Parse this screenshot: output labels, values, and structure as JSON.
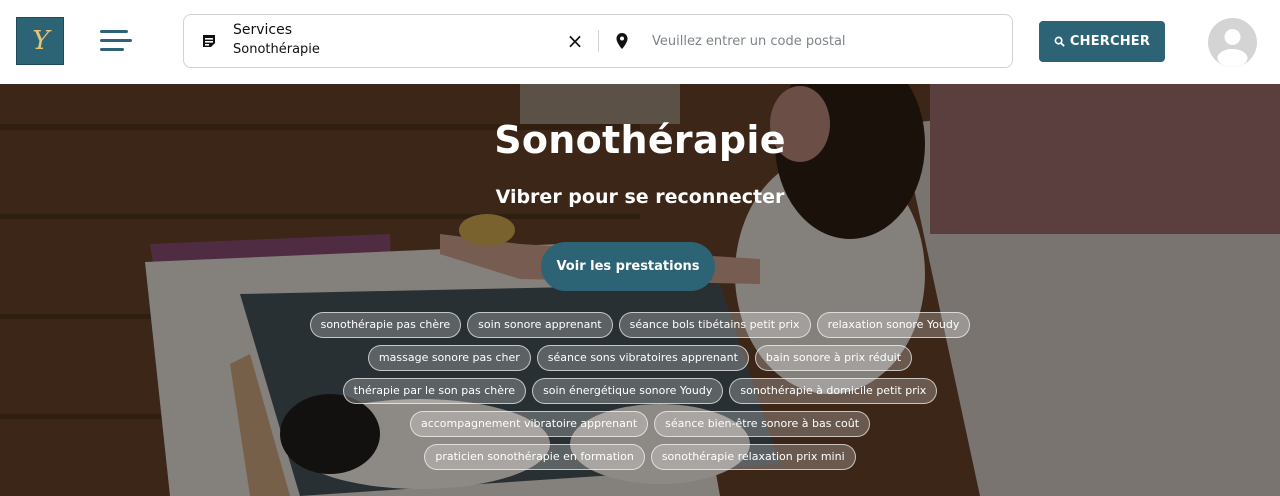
{
  "header": {
    "logo_text": "Y",
    "search": {
      "category_label": "Services",
      "service_value": "Sonothérapie",
      "clear_icon": "×",
      "postal_placeholder": "Veuillez entrer un code postal",
      "postal_value": ""
    },
    "search_button_label": "CHERCHER",
    "icons": [
      "menu-icon",
      "document-icon",
      "close-icon",
      "map-pin-icon",
      "search-icon",
      "user-avatar-icon"
    ]
  },
  "hero": {
    "title": "Sonothérapie",
    "subtitle": "Vibrer pour se reconnecter",
    "cta_label": "Voir les prestations",
    "tag_rows": [
      [
        "sonothérapie pas chère",
        "soin sonore apprenant",
        "séance bols tibétains petit prix",
        "relaxation sonore Youdy"
      ],
      [
        "massage sonore pas cher",
        "séance sons vibratoires apprenant",
        "bain sonore à prix réduit"
      ],
      [
        "thérapie par le son pas chère",
        "soin énergétique sonore Youdy",
        "sonothérapie à domicile petit prix"
      ],
      [
        "accompagnement vibratoire apprenant",
        "séance bien-être sonore à bas coût"
      ],
      [
        "praticien sonothérapie en formation",
        "sonothérapie relaxation prix mini"
      ]
    ]
  },
  "colors": {
    "brand": "#2d6475",
    "logo_accent": "#e6c37a",
    "header_bg": "#ffffff",
    "tag_border": "#ffffff"
  }
}
